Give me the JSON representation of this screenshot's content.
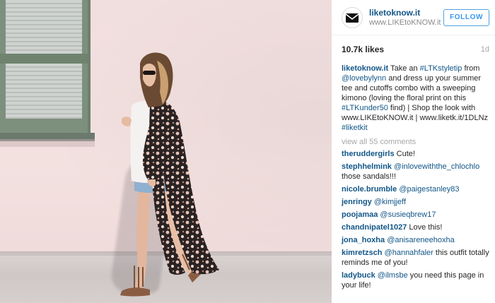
{
  "header": {
    "username": "liketoknow.it",
    "website": "www.LIKEtoKNOW.it",
    "follow_label": "FOLLOW",
    "avatar_icon": "envelope-logo-icon"
  },
  "meta": {
    "likes": "10.7k likes",
    "age": "1d"
  },
  "caption": {
    "username": "liketoknow.it",
    "t1": " Take an ",
    "tag1": "#LTKstyletip",
    "t2": " from ",
    "mention1": "@lovebylynn",
    "t3": " and dress up your summer tee and cutoffs combo with a sweeping kimono (loving the floral print on this ",
    "tag2": "#LTKunder50",
    "t4": " find) | Shop the look with www.LIKEtoKNOW.it | www.liketk.it/1DLNz ",
    "tag3": "#liketkit"
  },
  "view_all": "view all 55 comments",
  "comments": [
    {
      "user": "theruddergirls",
      "pre": " Cute!",
      "mention": "",
      "post": ""
    },
    {
      "user": "stephhelmink",
      "pre": " ",
      "mention": "@inlovewiththe_chlochlo",
      "post": " those sandals!!!"
    },
    {
      "user": "nicole.brumble",
      "pre": " ",
      "mention": "@paigestanley83",
      "post": ""
    },
    {
      "user": "jenringy",
      "pre": " ",
      "mention": "@kimjjeff",
      "post": ""
    },
    {
      "user": "poojamaa",
      "pre": " ",
      "mention": "@susieqbrew17",
      "post": ""
    },
    {
      "user": "chandnipatel1027",
      "pre": " Love this!",
      "mention": "",
      "post": ""
    },
    {
      "user": "jona_hoxha",
      "pre": " ",
      "mention": "@anisareneehoxha",
      "post": ""
    },
    {
      "user": "kimretzsch",
      "pre": " ",
      "mention": "@hannahfaler",
      "post": " this outfit totally reminds me of you!"
    },
    {
      "user": "ladybuck",
      "pre": " ",
      "mention": "@ilmsbe",
      "post": " you need this page in your life!"
    }
  ],
  "colors": {
    "link": "#125688",
    "follow": "#3897f0",
    "muted": "#a5a7aa"
  }
}
